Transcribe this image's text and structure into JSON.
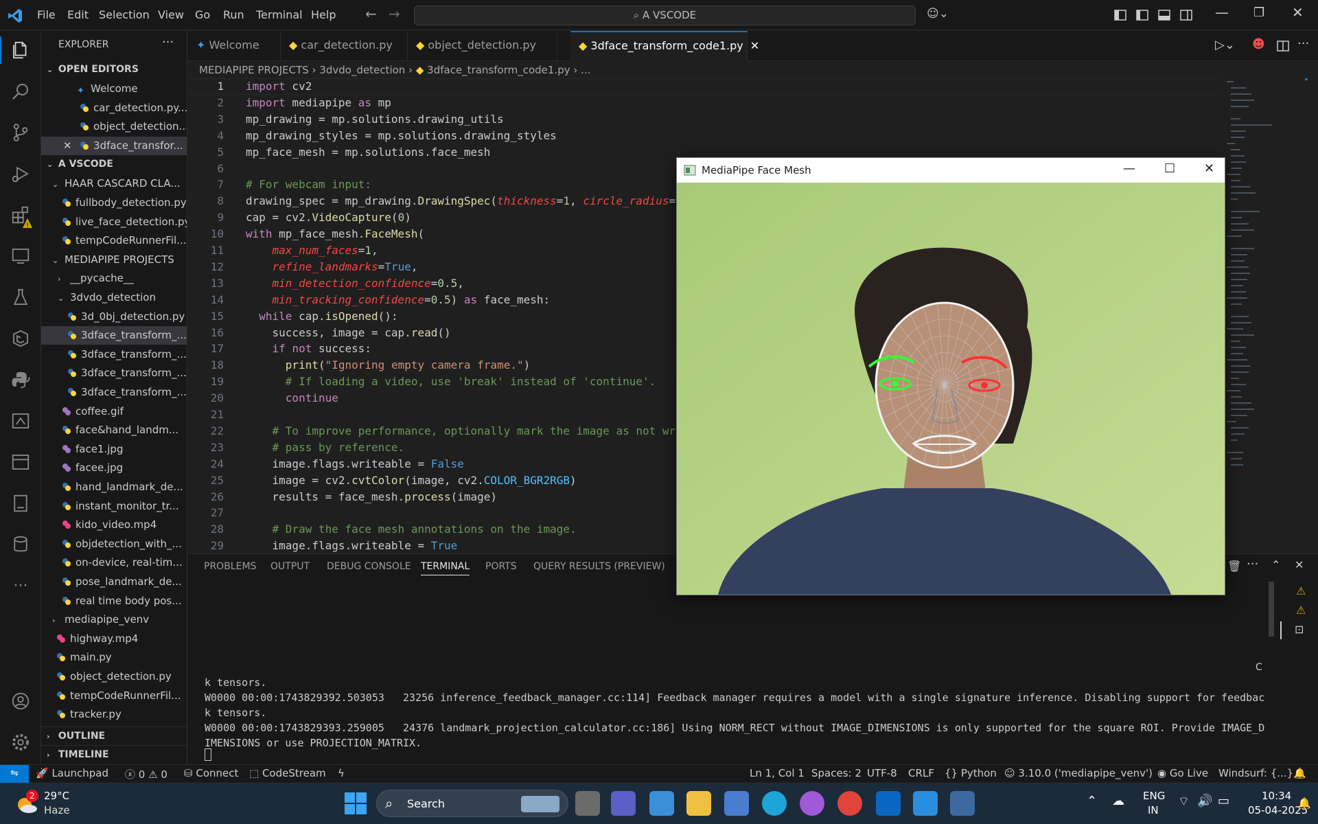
{
  "titlebar": {
    "menu": [
      "File",
      "Edit",
      "Selection",
      "View",
      "Go",
      "Run",
      "Terminal",
      "Help"
    ],
    "search": "A VSCODE"
  },
  "sidebar": {
    "title": "EXPLORER",
    "open_editors_label": "OPEN EDITORS",
    "open_editors": [
      "Welcome",
      "car_detection.py...",
      "object_detection...",
      "3dface_transfor..."
    ],
    "workspace_label": "A VSCODE",
    "tree": [
      "HAAR CASCARD CLA...",
      "fullbody_detection.py",
      "live_face_detection.py",
      "tempCodeRunnerFil...",
      "MEDIAPIPE PROJECTS",
      "__pycache__",
      "3dvdo_detection",
      "3d_0bj_detection.py",
      "3dface_transform_...",
      "3dface_transform_...",
      "3dface_transform_...",
      "3dface_transform_...",
      "coffee.gif",
      "face&hand_landm...",
      "face1.jpg",
      "facee.jpg",
      "hand_landmark_de...",
      "instant_monitor_tr...",
      "kido_video.mp4",
      "objdetection_with_...",
      "on-device, real-tim...",
      "pose_landmark_de...",
      "real time body pos...",
      "mediapipe_venv",
      "highway.mp4",
      "main.py",
      "object_detection.py",
      "tempCodeRunnerFil...",
      "tracker.py"
    ],
    "outline_label": "OUTLINE",
    "timeline_label": "TIMELINE"
  },
  "tabs": [
    "Welcome",
    "car_detection.py",
    "object_detection.py",
    "3dface_transform_code1.py"
  ],
  "breadcrumb": {
    "parts": [
      "MEDIAPIPE PROJECTS",
      "3dvdo_detection",
      "3dface_transform_code1.py",
      "..."
    ]
  },
  "editor": {
    "line_numbers": [
      "1",
      "2",
      "3",
      "4",
      "5",
      "6",
      "7",
      "8",
      "9",
      "10",
      "11",
      "12",
      "13",
      "14",
      "15",
      "16",
      "17",
      "18",
      "19",
      "20",
      "21",
      "22",
      "23",
      "24",
      "25",
      "26",
      "27",
      "28",
      "29"
    ],
    "lines": [
      "import cv2",
      "import mediapipe as mp",
      "mp_drawing = mp.solutions.drawing_utils",
      "mp_drawing_styles = mp.solutions.drawing_styles",
      "mp_face_mesh = mp.solutions.face_mesh",
      "",
      "# For webcam input:",
      "drawing_spec = mp_drawing.DrawingSpec(thickness=1, circle_radius=",
      "cap = cv2.VideoCapture(0)",
      "with mp_face_mesh.FaceMesh(",
      "    max_num_faces=1,",
      "    refine_landmarks=True,",
      "    min_detection_confidence=0.5,",
      "    min_tracking_confidence=0.5) as face_mesh:",
      "  while cap.isOpened():",
      "    success, image = cap.read()",
      "    if not success:",
      "      print(\"Ignoring empty camera frame.\")",
      "      # If loading a video, use 'break' instead of 'continue'.",
      "      continue",
      "",
      "    # To improve performance, optionally mark the image as not wr",
      "    # pass by reference.",
      "    image.flags.writeable = False",
      "    image = cv2.cvtColor(image, cv2.COLOR_BGR2RGB)",
      "    results = face_mesh.process(image)",
      "",
      "    # Draw the face mesh annotations on the image.",
      "    image.flags.writeable = True"
    ]
  },
  "panel": {
    "tabs": [
      "PROBLEMS",
      "OUTPUT",
      "DEBUG CONSOLE",
      "TERMINAL",
      "PORTS",
      "QUERY RESULTS (PREVIEW)"
    ],
    "terminal_lines": [
      "k tensors.",
      "W0000 00:00:1743829392.503053   23256 inference_feedback_manager.cc:114] Feedback manager requires a model with a single signature inference. Disabling support for feedbac",
      "k tensors.",
      "W0000 00:00:1743829393.259005   24376 landmark_projection_calculator.cc:186] Using NORM_RECT without IMAGE_DIMENSIONS is only supported for the square ROI. Provide IMAGE_D",
      "IMENSIONS or use PROJECTION_MATRIX."
    ],
    "side_letter": "C"
  },
  "statusbar": {
    "launchpad": "Launchpad",
    "errors": "0",
    "warnings": "0",
    "connect": "Connect",
    "codestream": "CodeStream",
    "position": "Ln 1, Col 1",
    "spaces": "Spaces: 2",
    "encoding": "UTF-8",
    "eol": "CRLF",
    "language": "Python",
    "interpreter": "3.10.0 ('mediapipe_venv')",
    "golive": "Go Live",
    "windsurf": "Windsurf: {...}"
  },
  "mediapipe_window": {
    "title": "MediaPipe Face Mesh"
  },
  "taskbar": {
    "weather_temp": "29°C",
    "weather_desc": "Haze",
    "weather_badge": "2",
    "search": "Search",
    "lang": "ENG",
    "region": "IN",
    "time": "10:34",
    "date": "05-04-2025"
  }
}
